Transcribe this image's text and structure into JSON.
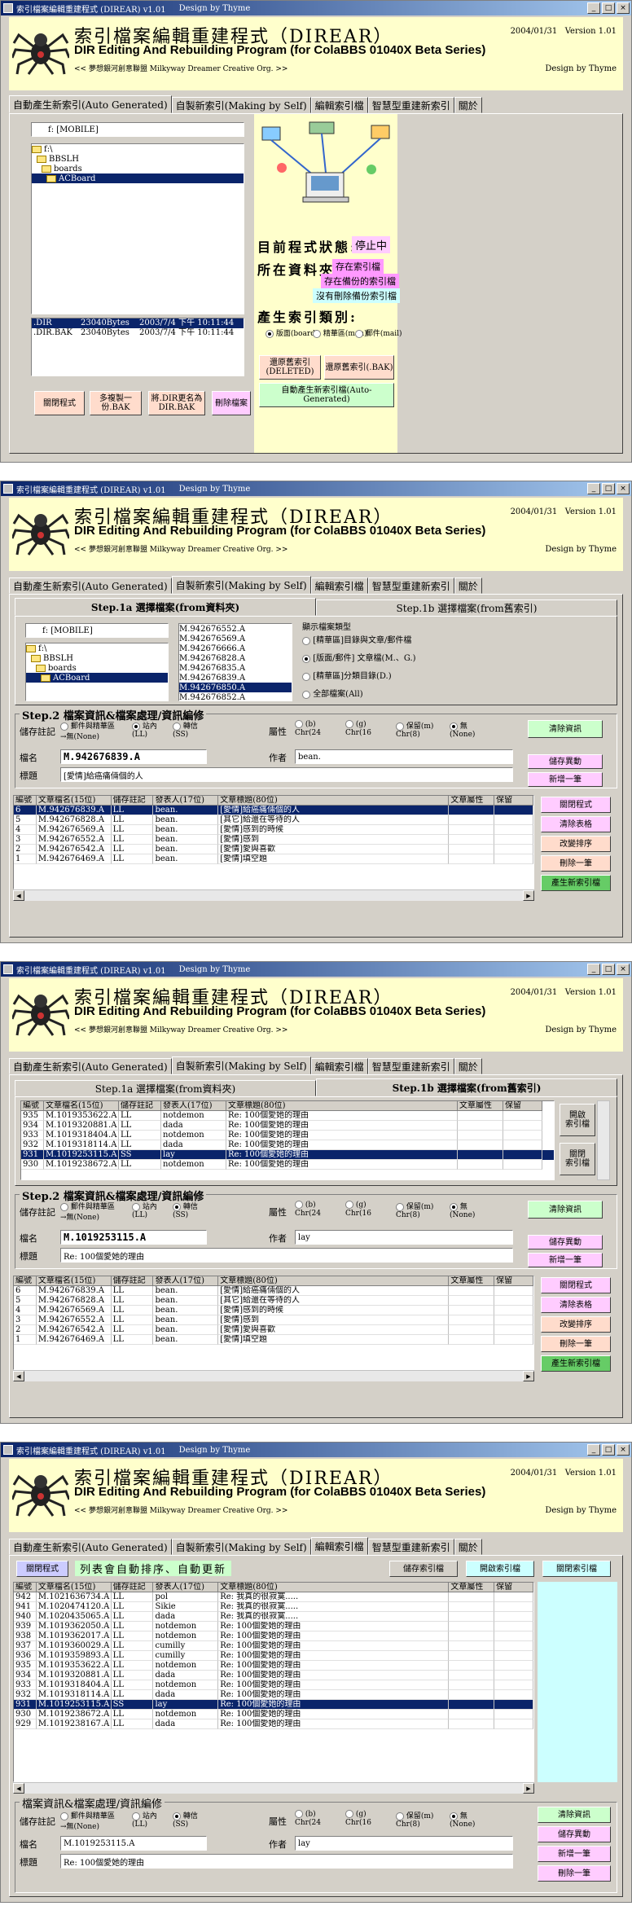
{
  "app": {
    "title": "索引檔案編輯重建程式 (DIREAR) v1.01",
    "design_tb": "Design by Thyme",
    "main_title": "索引檔案編輯重建程式（DIREAR）",
    "subtitle": "DIR Editing And Rebuilding Program (for ColaBBS 01040X Beta Series)",
    "org": "<< 夢想銀河創意聯盟 Milkyway Dreamer Creative Org. >>",
    "date": "2004/01/31",
    "version": "Version 1.01",
    "design": "Design by Thyme"
  },
  "tabs": [
    "自動產生新索引(Auto Generated)",
    "自製新索引(Making by Self)",
    "編輯索引檔",
    "智慧型重建新索引",
    "關於"
  ],
  "w1": {
    "drive": "f: [MOBILE]",
    "tree": [
      "f:\\",
      "BBSLH",
      "boards",
      "ACBoard"
    ],
    "files": [
      {
        "name": ".DIR",
        "size": "23040Bytes",
        "date": "2003/7/4 下午 10:11:44"
      },
      {
        "name": ".DIR.BAK",
        "size": "23040Bytes",
        "date": "2003/7/4 下午 10:11:44"
      }
    ],
    "status_label": "目前程式狀態:",
    "status_value": "停止中",
    "folder_label": "所在資料夾:",
    "chip1": "存在索引檔",
    "chip2": "存在備份的索引檔",
    "chip3": "沒有刪除備份索引檔",
    "type_label": "產生索引類別:",
    "radios": [
      "版面(board)",
      "精華區(man)",
      "郵件(mail)"
    ],
    "btn_restore_deleted": "還原舊索引\n(DELETED)",
    "btn_restore_bak": "還原舊索引(.BAK)",
    "btn_auto": "自動產生新索引檔(Auto-Generated)",
    "btn_close": "關閉程式",
    "btn_copy": "多複製一份.BAK",
    "btn_rename": "將.DIR更名為\nDIR.BAK",
    "btn_delete": "刪除檔案"
  },
  "w2": {
    "step1a": "Step.1a 選擇檔案(from資料夾)",
    "step1b": "Step.1b 選擇檔案(from舊索引)",
    "drive": "f: [MOBILE]",
    "tree": [
      "f:\\",
      "BBSLH",
      "boards",
      "ACBoard"
    ],
    "files": [
      "M.942676552.A",
      "M.942676569.A",
      "M.942676666.A",
      "M.942676828.A",
      "M.942676835.A",
      "M.942676839.A",
      "M.942676850.A",
      "M.942676852.A"
    ],
    "filetype_title": "顯示檔案類型",
    "filetypes": [
      "[精華區]目錄與文章/郵件檔",
      "[版面/郵件] 文章檔(M.、G.)",
      "[精華區]分類目錄(D.)",
      "全部檔案(All)"
    ],
    "step2": "Step.2 檔案資訊&檔案處理/資訊編修",
    "mark_label": "儲存註記",
    "marks": [
      "郵件與精華區\n→無(None)",
      "站內\n(LL)",
      "轉信\n(SS)"
    ],
    "attr_label": "屬性",
    "attrs": [
      "(b)\nChr(24",
      "(g)\nChr(16",
      "保留(m)\nChr(8)",
      "無\n(None)"
    ],
    "name_label": "檔名",
    "name_value": "M.942676839.A",
    "author_label": "作者",
    "author_value": "bean.",
    "subject_label": "標題",
    "subject_value": "[愛情]給癌痛倆個的人",
    "btn_clear": "清除資訊",
    "btn_save": "儲存異動",
    "btn_add": "新增一筆",
    "cols": [
      "編號",
      "文章檔名(15位)",
      "儲存註記",
      "發表人(17位)",
      "文章標題(80位)",
      "文章屬性",
      "保留"
    ],
    "rows": [
      [
        "6",
        "M.942676839.A",
        "LL",
        "bean.",
        "[愛情]給癌痛倆個的人",
        "",
        ""
      ],
      [
        "5",
        "M.942676828.A",
        "LL",
        "bean.",
        "[其它]給還在等待的人",
        "",
        ""
      ],
      [
        "4",
        "M.942676569.A",
        "LL",
        "bean.",
        "[愛情]感到的時候",
        "",
        ""
      ],
      [
        "3",
        "M.942676552.A",
        "LL",
        "bean.",
        "[愛情]感到",
        "",
        ""
      ],
      [
        "2",
        "M.942676542.A",
        "LL",
        "bean.",
        "[愛情]愛與喜歡",
        "",
        ""
      ],
      [
        "1",
        "M.942676469.A",
        "LL",
        "bean.",
        "[愛情]填空題",
        "",
        ""
      ]
    ],
    "side": [
      "關閉程式",
      "清除表格",
      "改變排序",
      "刪除一筆",
      "產生新索引檔"
    ]
  },
  "w3": {
    "step1a": "Step.1a 選擇檔案(from資料夾)",
    "step1b": "Step.1b 選擇檔案(from舊索引)",
    "cols": [
      "編號",
      "文章檔名(15位)",
      "儲存註記",
      "發表人(17位)",
      "文章標題(80位)",
      "文章屬性",
      "保留"
    ],
    "rows": [
      [
        "935",
        "M.1019353622.A",
        "LL",
        "notdemon",
        "Re: 100個愛她的理由"
      ],
      [
        "934",
        "M.1019320881.A",
        "LL",
        "dada",
        "Re: 100個愛她的理由"
      ],
      [
        "933",
        "M.1019318404.A",
        "LL",
        "notdemon",
        "Re: 100個愛她的理由"
      ],
      [
        "932",
        "M.1019318114.A",
        "LL",
        "dada",
        "Re: 100個愛她的理由"
      ],
      [
        "931",
        "M.1019253115.A",
        "SS",
        "lay",
        "Re: 100個愛她的理由"
      ],
      [
        "930",
        "M.1019238672.A",
        "LL",
        "notdemon",
        "Re: 100個愛她的理由"
      ]
    ],
    "btn_open": "開啟\n索引檔",
    "btn_close_idx": "關閉\n索引檔",
    "step2": "Step.2 檔案資訊&檔案處理/資訊編修",
    "name_value": "M.1019253115.A",
    "author_value": "lay",
    "subject_value": "Re: 100個愛她的理由",
    "rows2": [
      [
        "6",
        "M.942676839.A",
        "LL",
        "bean.",
        "[愛情]給癌痛倆個的人"
      ],
      [
        "5",
        "M.942676828.A",
        "LL",
        "bean.",
        "[其它]給還在等待的人"
      ],
      [
        "4",
        "M.942676569.A",
        "LL",
        "bean.",
        "[愛情]感到的時候"
      ],
      [
        "3",
        "M.942676552.A",
        "LL",
        "bean.",
        "[愛情]感到"
      ],
      [
        "2",
        "M.942676542.A",
        "LL",
        "bean.",
        "[愛情]愛與喜歡"
      ],
      [
        "1",
        "M.942676469.A",
        "LL",
        "bean.",
        "[愛情]填空題"
      ]
    ]
  },
  "w4": {
    "btn_close": "關閉程式",
    "notice": "列表會自動排序、自動更新",
    "btn_save_idx": "儲存索引檔",
    "btn_open_idx": "開啟索引檔",
    "btn_close_idx": "關閉索引檔",
    "rows": [
      [
        "942",
        "M.1021636734.A",
        "LL",
        "pol",
        "Re: 我真的很寂寞....."
      ],
      [
        "941",
        "M.1020474120.A",
        "LL",
        "Sikie",
        "Re: 我真的很寂寞....."
      ],
      [
        "940",
        "M.1020435065.A",
        "LL",
        "dada",
        "Re: 我真的很寂寞....."
      ],
      [
        "939",
        "M.1019362050.A",
        "LL",
        "notdemon",
        "Re: 100個愛她的理由"
      ],
      [
        "938",
        "M.1019362017.A",
        "LL",
        "notdemon",
        "Re: 100個愛她的理由"
      ],
      [
        "937",
        "M.1019360029.A",
        "LL",
        "cumilly",
        "Re: 100個愛她的理由"
      ],
      [
        "936",
        "M.1019359893.A",
        "LL",
        "cumilly",
        "Re: 100個愛她的理由"
      ],
      [
        "935",
        "M.1019353622.A",
        "LL",
        "notdemon",
        "Re: 100個愛她的理由"
      ],
      [
        "934",
        "M.1019320881.A",
        "LL",
        "dada",
        "Re: 100個愛她的理由"
      ],
      [
        "933",
        "M.1019318404.A",
        "LL",
        "notdemon",
        "Re: 100個愛她的理由"
      ],
      [
        "932",
        "M.1019318114.A",
        "LL",
        "dada",
        "Re: 100個愛她的理由"
      ],
      [
        "931",
        "M.1019253115.A",
        "SS",
        "lay",
        "Re: 100個愛她的理由"
      ],
      [
        "930",
        "M.1019238672.A",
        "LL",
        "notdemon",
        "Re: 100個愛她的理由"
      ],
      [
        "929",
        "M.1019238167.A",
        "LL",
        "dada",
        "Re: 100個愛她的理由"
      ]
    ],
    "section": "檔案資訊&檔案處理/資訊編修",
    "name_value": "M.1019253115.A",
    "author_value": "lay",
    "subject_value": "Re: 100個愛她的理由",
    "side": [
      "清除資訊",
      "儲存異動",
      "新增一筆",
      "刪除一筆"
    ]
  }
}
